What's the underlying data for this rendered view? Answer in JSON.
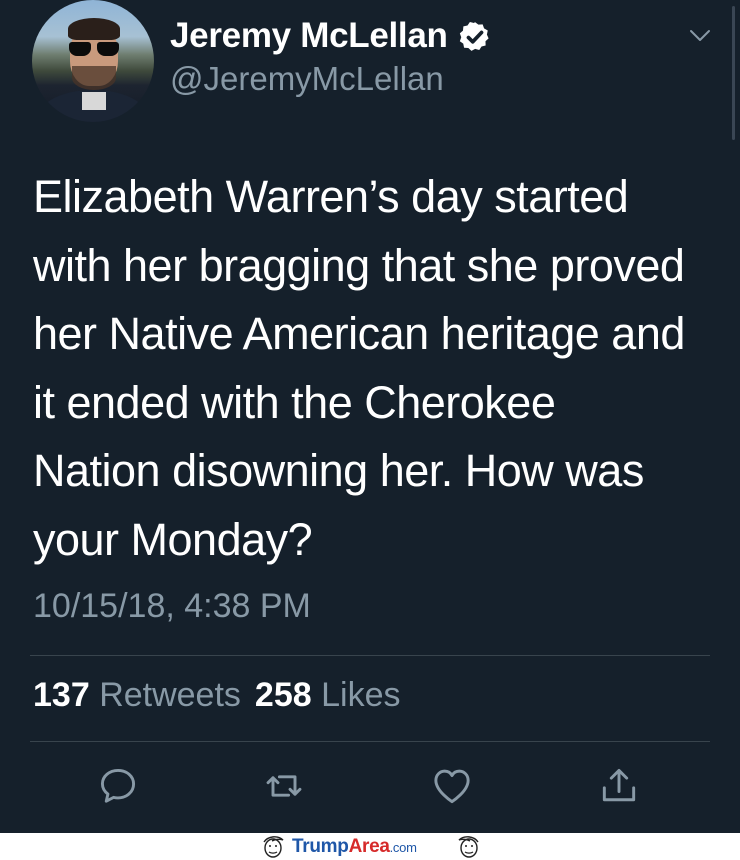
{
  "author": {
    "name": "Jeremy McLellan",
    "handle": "@JeremyMcLellan",
    "verified": true
  },
  "tweet": {
    "text": "Elizabeth Warren’s day started\nwith her bragging that she proved\nher Native American heritage and\nit ended with the Cherokee\nNation disowning her. How was\nyour Monday?",
    "timestamp": "10/15/18, 4:38 PM"
  },
  "stats": {
    "retweets_count": "137",
    "retweets_label": "Retweets",
    "likes_count": "258",
    "likes_label": "Likes"
  },
  "actions": [
    "reply-icon",
    "retweet-icon",
    "like-icon",
    "share-icon"
  ],
  "watermark": {
    "brand_part1": "Trump",
    "brand_part2": "Area",
    "brand_part3": ".com"
  },
  "colors": {
    "background": "#15202b",
    "secondary_text": "#8899a6",
    "divider": "#38444d",
    "watermark_blue": "#1f57a8",
    "watermark_red": "#d62a2a"
  }
}
